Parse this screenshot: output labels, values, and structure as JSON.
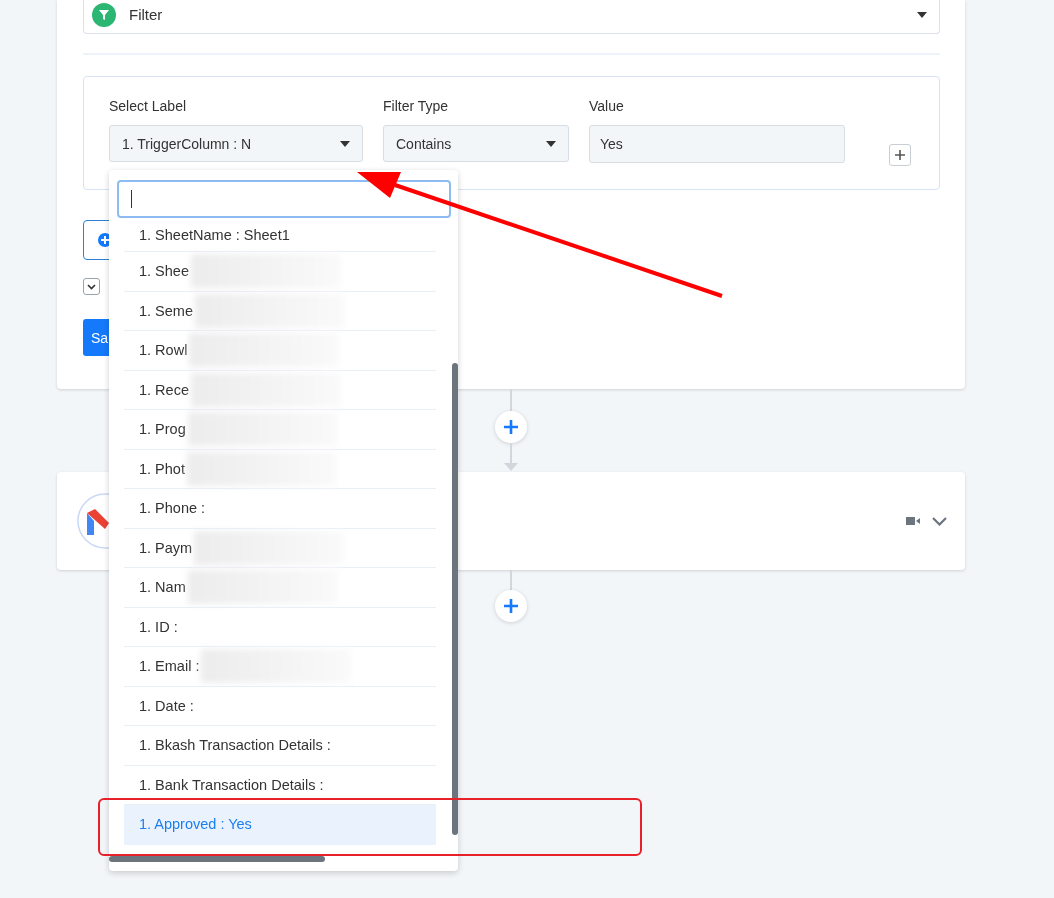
{
  "trigger_step": {
    "title": "Filter"
  },
  "filter_rule": {
    "fields": [
      {
        "label": "Select Label",
        "kind": "select",
        "value": "1. TriggerColumn : N"
      },
      {
        "label": "Filter Type",
        "kind": "select",
        "value": "Contains"
      },
      {
        "label": "Value",
        "kind": "input",
        "value": "Yes"
      }
    ]
  },
  "save_button": {
    "label": "Sa"
  },
  "label_dropdown": {
    "options": [
      {
        "label": "1. SheetName : Sheet1",
        "selected": false,
        "redacted": false
      },
      {
        "label": "1. Shee",
        "selected": false,
        "redacted": true
      },
      {
        "label": "1. Seme",
        "selected": false,
        "redacted": true
      },
      {
        "label": "1. Rowl",
        "selected": false,
        "redacted": true
      },
      {
        "label": "1. Rece",
        "selected": false,
        "redacted": true
      },
      {
        "label": "1. Prog",
        "selected": false,
        "redacted": true
      },
      {
        "label": "1. Phot",
        "selected": false,
        "redacted": true
      },
      {
        "label": "1. Phone :",
        "selected": false,
        "redacted": false
      },
      {
        "label": "1. Paym",
        "selected": false,
        "redacted": true
      },
      {
        "label": "1. Nam",
        "selected": false,
        "redacted": true
      },
      {
        "label": "1. ID :",
        "selected": false,
        "redacted": false
      },
      {
        "label": "1. Email :",
        "selected": false,
        "redacted": true
      },
      {
        "label": "1. Date :",
        "selected": false,
        "redacted": false
      },
      {
        "label": "1. Bkash Transaction Details :",
        "selected": false,
        "redacted": false
      },
      {
        "label": "1. Bank Transaction Details :",
        "selected": false,
        "redacted": false
      },
      {
        "label": "1. Approved : Yes",
        "selected": true,
        "redacted": false
      }
    ]
  },
  "annotations": [
    {
      "kind": "arrow",
      "color": "#ff0000"
    },
    {
      "kind": "highlight",
      "color": "#e8202a"
    }
  ]
}
